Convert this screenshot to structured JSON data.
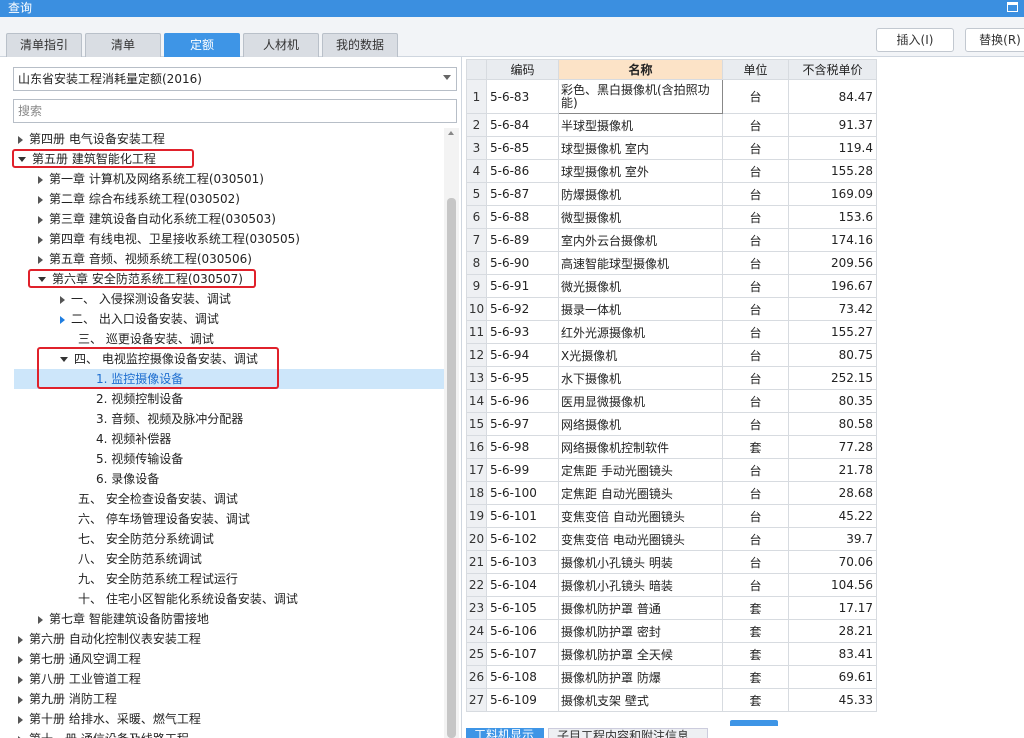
{
  "window": {
    "title": "查询"
  },
  "tabs": [
    {
      "label": "清单指引",
      "active": false
    },
    {
      "label": "清单",
      "active": false
    },
    {
      "label": "定额",
      "active": true
    },
    {
      "label": "人材机",
      "active": false
    },
    {
      "label": "我的数据",
      "active": false
    }
  ],
  "toolbar": {
    "insert_label": "插入(I)",
    "replace_label": "替换(R)"
  },
  "left": {
    "quota_select": "山东省安装工程消耗量定额(2016)",
    "search_placeholder": "搜索"
  },
  "tree": [
    {
      "label": "第四册 电气设备安装工程",
      "expanded": false
    },
    {
      "label": "第五册 建筑智能化工程",
      "expanded": true
    },
    {
      "label": "第一章 计算机及网络系统工程(030501)",
      "expanded": false
    },
    {
      "label": "第二章 综合布线系统工程(030502)",
      "expanded": false
    },
    {
      "label": "第三章 建筑设备自动化系统工程(030503)",
      "expanded": false
    },
    {
      "label": "第四章 有线电视、卫星接收系统工程(030505)",
      "expanded": false
    },
    {
      "label": "第五章 音频、视频系统工程(030506)",
      "expanded": false
    },
    {
      "label": "第六章 安全防范系统工程(030507)",
      "expanded": true
    },
    {
      "label": "一、 入侵探测设备安装、调试",
      "expanded": false
    },
    {
      "label": "二、 出入口设备安装、调试",
      "expanded": false
    },
    {
      "label": "三、 巡更设备安装、调试",
      "expanded": false
    },
    {
      "label": "四、 电视监控摄像设备安装、调试",
      "expanded": true
    },
    {
      "label": "1. 监控摄像设备",
      "selected": true
    },
    {
      "label": "2. 视频控制设备"
    },
    {
      "label": "3. 音频、视频及脉冲分配器"
    },
    {
      "label": "4. 视频补偿器"
    },
    {
      "label": "5. 视频传输设备"
    },
    {
      "label": "6. 录像设备"
    },
    {
      "label": "五、 安全检查设备安装、调试"
    },
    {
      "label": "六、 停车场管理设备安装、调试"
    },
    {
      "label": "七、 安全防范分系统调试"
    },
    {
      "label": "八、 安全防范系统调试"
    },
    {
      "label": "九、 安全防范系统工程试运行"
    },
    {
      "label": "十、 住宅小区智能化系统设备安装、调试"
    },
    {
      "label": "第七章 智能建筑设备防雷接地",
      "expanded": false
    },
    {
      "label": "第六册 自动化控制仪表安装工程",
      "expanded": false
    },
    {
      "label": "第七册 通风空调工程",
      "expanded": false
    },
    {
      "label": "第八册 工业管道工程",
      "expanded": false
    },
    {
      "label": "第九册 消防工程",
      "expanded": false
    },
    {
      "label": "第十册 给排水、采暖、燃气工程",
      "expanded": false
    },
    {
      "label": "第十一册 通信设备及线路工程",
      "expanded": false
    }
  ],
  "table": {
    "columns": [
      "编码",
      "名称",
      "单位",
      "不含税单价"
    ],
    "rows": [
      {
        "idx": "1",
        "code": "5-6-83",
        "name": "彩色、黑白摄像机(含拍照功能)",
        "unit": "台",
        "price": "84.47"
      },
      {
        "idx": "2",
        "code": "5-6-84",
        "name": "半球型摄像机",
        "unit": "台",
        "price": "91.37"
      },
      {
        "idx": "3",
        "code": "5-6-85",
        "name": "球型摄像机 室内",
        "unit": "台",
        "price": "119.4"
      },
      {
        "idx": "4",
        "code": "5-6-86",
        "name": "球型摄像机 室外",
        "unit": "台",
        "price": "155.28"
      },
      {
        "idx": "5",
        "code": "5-6-87",
        "name": "防爆摄像机",
        "unit": "台",
        "price": "169.09"
      },
      {
        "idx": "6",
        "code": "5-6-88",
        "name": "微型摄像机",
        "unit": "台",
        "price": "153.6"
      },
      {
        "idx": "7",
        "code": "5-6-89",
        "name": "室内外云台摄像机",
        "unit": "台",
        "price": "174.16"
      },
      {
        "idx": "8",
        "code": "5-6-90",
        "name": "高速智能球型摄像机",
        "unit": "台",
        "price": "209.56"
      },
      {
        "idx": "9",
        "code": "5-6-91",
        "name": "微光摄像机",
        "unit": "台",
        "price": "196.67"
      },
      {
        "idx": "10",
        "code": "5-6-92",
        "name": "摄录一体机",
        "unit": "台",
        "price": "73.42"
      },
      {
        "idx": "11",
        "code": "5-6-93",
        "name": "红外光源摄像机",
        "unit": "台",
        "price": "155.27"
      },
      {
        "idx": "12",
        "code": "5-6-94",
        "name": "X光摄像机",
        "unit": "台",
        "price": "80.75"
      },
      {
        "idx": "13",
        "code": "5-6-95",
        "name": "水下摄像机",
        "unit": "台",
        "price": "252.15"
      },
      {
        "idx": "14",
        "code": "5-6-96",
        "name": "医用显微摄像机",
        "unit": "台",
        "price": "80.35"
      },
      {
        "idx": "15",
        "code": "5-6-97",
        "name": "网络摄像机",
        "unit": "台",
        "price": "80.58"
      },
      {
        "idx": "16",
        "code": "5-6-98",
        "name": "网络摄像机控制软件",
        "unit": "套",
        "price": "77.28"
      },
      {
        "idx": "17",
        "code": "5-6-99",
        "name": "定焦距 手动光圈镜头",
        "unit": "台",
        "price": "21.78"
      },
      {
        "idx": "18",
        "code": "5-6-100",
        "name": "定焦距 自动光圈镜头",
        "unit": "台",
        "price": "28.68"
      },
      {
        "idx": "19",
        "code": "5-6-101",
        "name": "变焦变倍 自动光圈镜头",
        "unit": "台",
        "price": "45.22"
      },
      {
        "idx": "20",
        "code": "5-6-102",
        "name": "变焦变倍 电动光圈镜头",
        "unit": "台",
        "price": "39.7"
      },
      {
        "idx": "21",
        "code": "5-6-103",
        "name": "摄像机小孔镜头 明装",
        "unit": "台",
        "price": "70.06"
      },
      {
        "idx": "22",
        "code": "5-6-104",
        "name": "摄像机小孔镜头 暗装",
        "unit": "台",
        "price": "104.56"
      },
      {
        "idx": "23",
        "code": "5-6-105",
        "name": "摄像机防护罩 普通",
        "unit": "套",
        "price": "17.17"
      },
      {
        "idx": "24",
        "code": "5-6-106",
        "name": "摄像机防护罩 密封",
        "unit": "套",
        "price": "28.21"
      },
      {
        "idx": "25",
        "code": "5-6-107",
        "name": "摄像机防护罩 全天候",
        "unit": "套",
        "price": "83.41"
      },
      {
        "idx": "26",
        "code": "5-6-108",
        "name": "摄像机防护罩 防爆",
        "unit": "套",
        "price": "69.61"
      },
      {
        "idx": "27",
        "code": "5-6-109",
        "name": "摄像机支架 壁式",
        "unit": "套",
        "price": "45.33"
      }
    ]
  },
  "bottom_tabs": [
    {
      "label": "工料机显示",
      "active": true
    },
    {
      "label": "子目工程内容和附注信息",
      "active": false
    }
  ]
}
